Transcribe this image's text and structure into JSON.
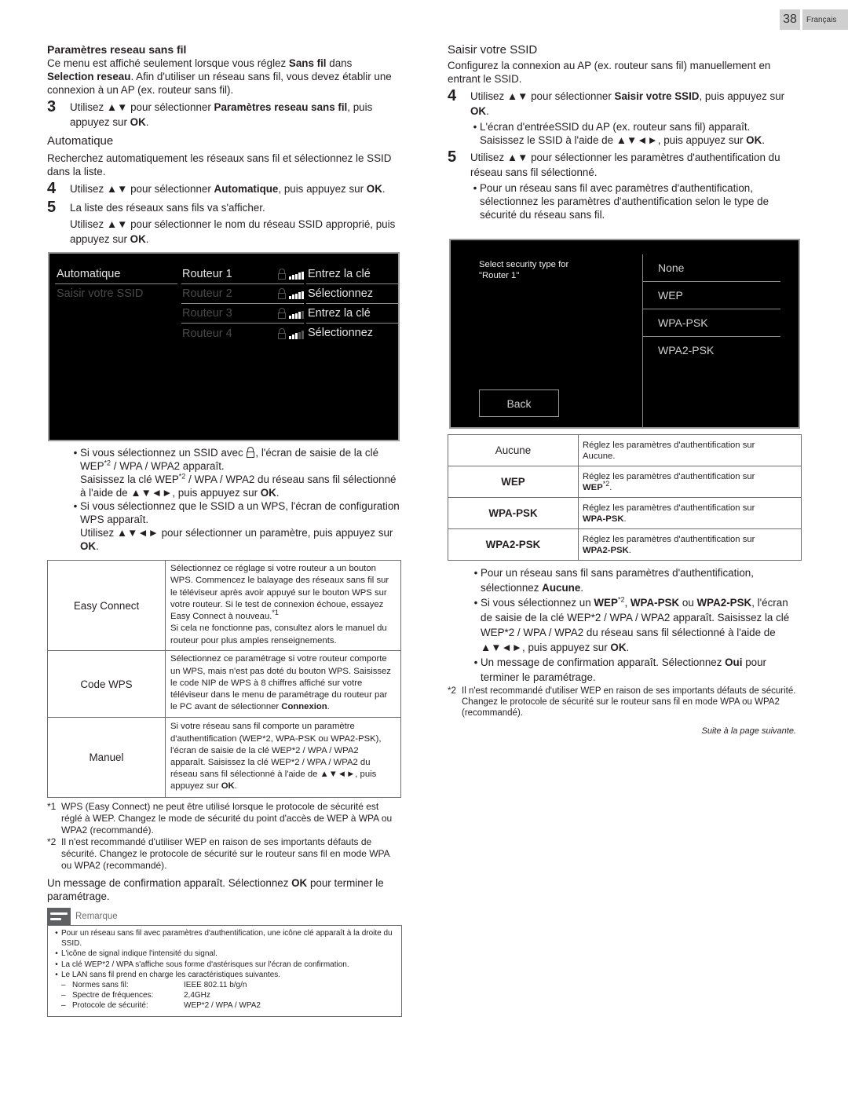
{
  "page_header": {
    "page_number": "38",
    "language": "Français"
  },
  "left": {
    "section1_title": "Paramètres reseau sans fil",
    "section1_intro_pre": "Ce menu est affiché seulement lorsque vous réglez ",
    "section1_intro_b1": "Sans fil",
    "section1_intro_mid": " dans ",
    "section1_intro_b2": "Selection reseau",
    "section1_intro_post": ". Afin d'utiliser un réseau sans fil, vous devez établir une connexion à un AP (ex. routeur sans fil).",
    "step3_num": "3",
    "step3_pre": "Utilisez ▲▼ pour sélectionner ",
    "step3_bold": "Paramètres reseau sans fil",
    "step3_mid": ", puis appuyez sur ",
    "step3_ok": "OK",
    "step3_end": ".",
    "section2_title": "Automatique",
    "section2_intro": "Recherchez automatiquement les réseaux sans fil et sélectionnez le SSID dans la liste.",
    "step4_num": "4",
    "step4_pre": "Utilisez ▲▼ pour sélectionner ",
    "step4_bold": "Automatique",
    "step4_mid": ", puis appuyez sur ",
    "step4_ok": "OK",
    "step4_end": ".",
    "step5_num": "5",
    "step5_line1": "La liste des réseaux sans fils va s'afficher.",
    "step5_line2_pre": "Utilisez ▲▼ pour sélectionner le nom du réseau SSID approprié, puis appuyez sur ",
    "step5_ok": "OK",
    "step5_end": "."
  },
  "tv_screen_1": {
    "menu": [
      {
        "label": "Automatique",
        "state": "selected"
      },
      {
        "label": "Saisir votre SSID",
        "state": "dim"
      }
    ],
    "routers": [
      {
        "name": "Routeur 1",
        "locked": true,
        "signal_bars": 5,
        "signal_max": 5,
        "action": "Entrez la clé"
      },
      {
        "name": "Routeur 2",
        "locked": true,
        "signal_bars": 5,
        "signal_max": 5,
        "action": "Sélectionnez"
      },
      {
        "name": "Routeur 3",
        "locked": true,
        "signal_bars": 4,
        "signal_max": 5,
        "action": "Entrez la clé"
      },
      {
        "name": "Routeur 4",
        "locked": true,
        "signal_bars": 3,
        "signal_max": 5,
        "action": "Sélectionnez"
      }
    ]
  },
  "left_bullets": {
    "b1_pre": "Si vous sélectionnez un SSID avec ",
    "b1_post": ", l'écran de saisie de la clé WEP",
    "b1_sup": "*2",
    "b1_end": " / WPA / WPA2 apparaît.",
    "b1_line2_pre": "Saisissez la clé WEP",
    "b1_line2_sup": "*2",
    "b1_line2_mid": " / WPA / WPA2 du réseau sans fil sélectionné à l'aide de ▲▼◄►, puis appuyez sur ",
    "b1_ok": "OK",
    "b1_end2": ".",
    "b2_line1": "Si vous sélectionnez que le SSID a un WPS, l'écran de configuration WPS apparaît.",
    "b2_line2_pre": "Utilisez ▲▼◄► pour sélectionner un paramètre, puis appuyez sur ",
    "b2_ok": "OK",
    "b2_end": "."
  },
  "wps_table": [
    {
      "key": "Easy Connect",
      "desc": "Sélectionnez ce réglage si votre routeur a un bouton WPS. Commencez le balayage des réseaux sans fil sur le téléviseur après avoir appuyé sur le bouton WPS sur votre routeur. Si le test de connexion échoue, essayez Easy Connect à nouveau.",
      "desc_sup": "*1",
      "desc2": "Si cela ne fonctionne pas, consultez alors le manuel du routeur pour plus amples renseignements."
    },
    {
      "key": "Code WPS",
      "desc": "Sélectionnez ce paramétrage si votre routeur comporte un WPS, mais n'est pas doté du bouton WPS. Saisissez le code NIP de WPS à 8 chiffres affiché sur votre téléviseur dans le menu de paramétrage du routeur par le PC avant de sélectionner ",
      "desc_bold": "Connexion",
      "desc_end": "."
    },
    {
      "key": "Manuel",
      "desc": "Si votre réseau sans fil comporte un paramètre d'authentification (WEP*2, WPA-PSK ou WPA2-PSK), l'écran de saisie de la clé WEP*2 / WPA / WPA2 apparaît. Saisissez la clé WEP*2 / WPA / WPA2 du réseau sans fil sélectionné à l'aide de ▲▼◄►, puis appuyez sur ",
      "desc_bold": "OK",
      "desc_end": "."
    }
  ],
  "left_footnotes": [
    {
      "mark": "*1",
      "text": "WPS (Easy Connect) ne peut être utilisé lorsque le protocole de sécurité est réglé à WEP. Changez le mode de sécurité du point d'accès de WEP à WPA ou WPA2 (recommandé)."
    },
    {
      "mark": "*2",
      "text": "Il n'est recommandé d'utiliser WEP en raison de ses importants défauts de sécurité. Changez le protocole de sécurité sur le routeur sans fil en mode WPA ou WPA2 (recommandé)."
    }
  ],
  "confirm_msg": {
    "pre": "Un message de confirmation apparaît. Sélectionnez ",
    "ok": "OK",
    "post": " pour terminer le paramétrage."
  },
  "remarque": {
    "title": "Remarque",
    "items": [
      "Pour un réseau sans fil avec paramètres d'authentification, une icône clé apparaît à la droite du SSID.",
      "L'icône de signal indique l'intensité du signal.",
      "La clé WEP*2 / WPA s'affiche sous forme d'astérisques sur l'écran de confirmation.",
      "Le LAN sans fil prend en charge les caractéristiques suivantes."
    ],
    "specs": [
      {
        "label": "Normes sans fil:",
        "value": "IEEE 802.11 b/g/n"
      },
      {
        "label": "Spectre de fréquences:",
        "value": "2,4GHz"
      },
      {
        "label": "Protocole de sécurité:",
        "value": "WEP*2 / WPA / WPA2"
      }
    ]
  },
  "right": {
    "section_title": "Saisir votre SSID",
    "intro": "Configurez la connexion au AP (ex. routeur sans fil) manuellement en entrant le SSID.",
    "step4_num": "4",
    "step4_pre": "Utilisez ▲▼ pour sélectionner ",
    "step4_bold": "Saisir votre SSID",
    "step4_mid": ", puis appuyez sur ",
    "step4_ok": "OK",
    "step4_end": ".",
    "step4_bullet_l1": "L'écran d'entréeSSID du AP (ex. routeur sans fil) apparaît.",
    "step4_bullet_l2_pre": "Saisissez le SSID à l'aide de ▲▼◄►, puis appuyez sur ",
    "step4_bullet_ok": "OK",
    "step4_bullet_end": ".",
    "step5_num": "5",
    "step5_text": "Utilisez ▲▼ pour sélectionner les paramètres d'authentification du réseau sans fil sélectionné.",
    "step5_bullet": "Pour un réseau sans fil avec paramètres d'authentification, sélectionnez les paramètres d'authentification selon le type de sécurité du réseau sans fil."
  },
  "tv_screen_2": {
    "prompt_line1": "Select security type for",
    "prompt_line2": "\"Router 1\"",
    "options": [
      "None",
      "WEP",
      "WPA-PSK",
      "WPA2-PSK"
    ],
    "back_label": "Back"
  },
  "auth_table": [
    {
      "key": "Aucune",
      "desc": "Réglez les paramètres d'authentification sur",
      "value": "Aucune",
      "sup": ""
    },
    {
      "key": "WEP",
      "desc": "Réglez les paramètres d'authentification sur",
      "value": "WEP",
      "sup": "*2"
    },
    {
      "key": "WPA-PSK",
      "desc": "Réglez les paramètres d'authentification sur",
      "value": "WPA-PSK",
      "sup": ""
    },
    {
      "key": "WPA2-PSK",
      "desc": "Réglez les paramètres d'authentification sur",
      "value": "WPA2-PSK",
      "sup": ""
    }
  ],
  "right_bullets": {
    "b1_pre": "Pour un réseau sans fil sans paramètres d'authentification, sélectionnez ",
    "b1_bold": "Aucune",
    "b1_end": ".",
    "b2_pre": "Si vous sélectionnez un ",
    "b2_b1": "WEP",
    "b2_sup": "*2",
    "b2_sep1": ", ",
    "b2_b2": "WPA-PSK",
    "b2_or": " ou ",
    "b2_b3": "WPA2-PSK",
    "b2_post": ", l'écran de saisie de la clé WEP*2 / WPA / WPA2 apparaît. Saisissez la clé WEP*2 / WPA / WPA2 du réseau sans fil sélectionné à l'aide de ▲▼◄►, puis appuyez sur ",
    "b2_ok": "OK",
    "b2_end": ".",
    "b3_pre": "Un message de confirmation apparaît. Sélectionnez ",
    "b3_bold": "Oui",
    "b3_post": " pour terminer le paramétrage."
  },
  "right_footnote": {
    "mark": "*2",
    "line1": "Il n'est recommandé d'utiliser WEP en raison de ses importants défauts de sécurité.",
    "line2": "Changez le protocole de sécurité sur le routeur sans fil en mode WPA ou WPA2 (recommandé)."
  },
  "continued": "Suite à la page suivante."
}
